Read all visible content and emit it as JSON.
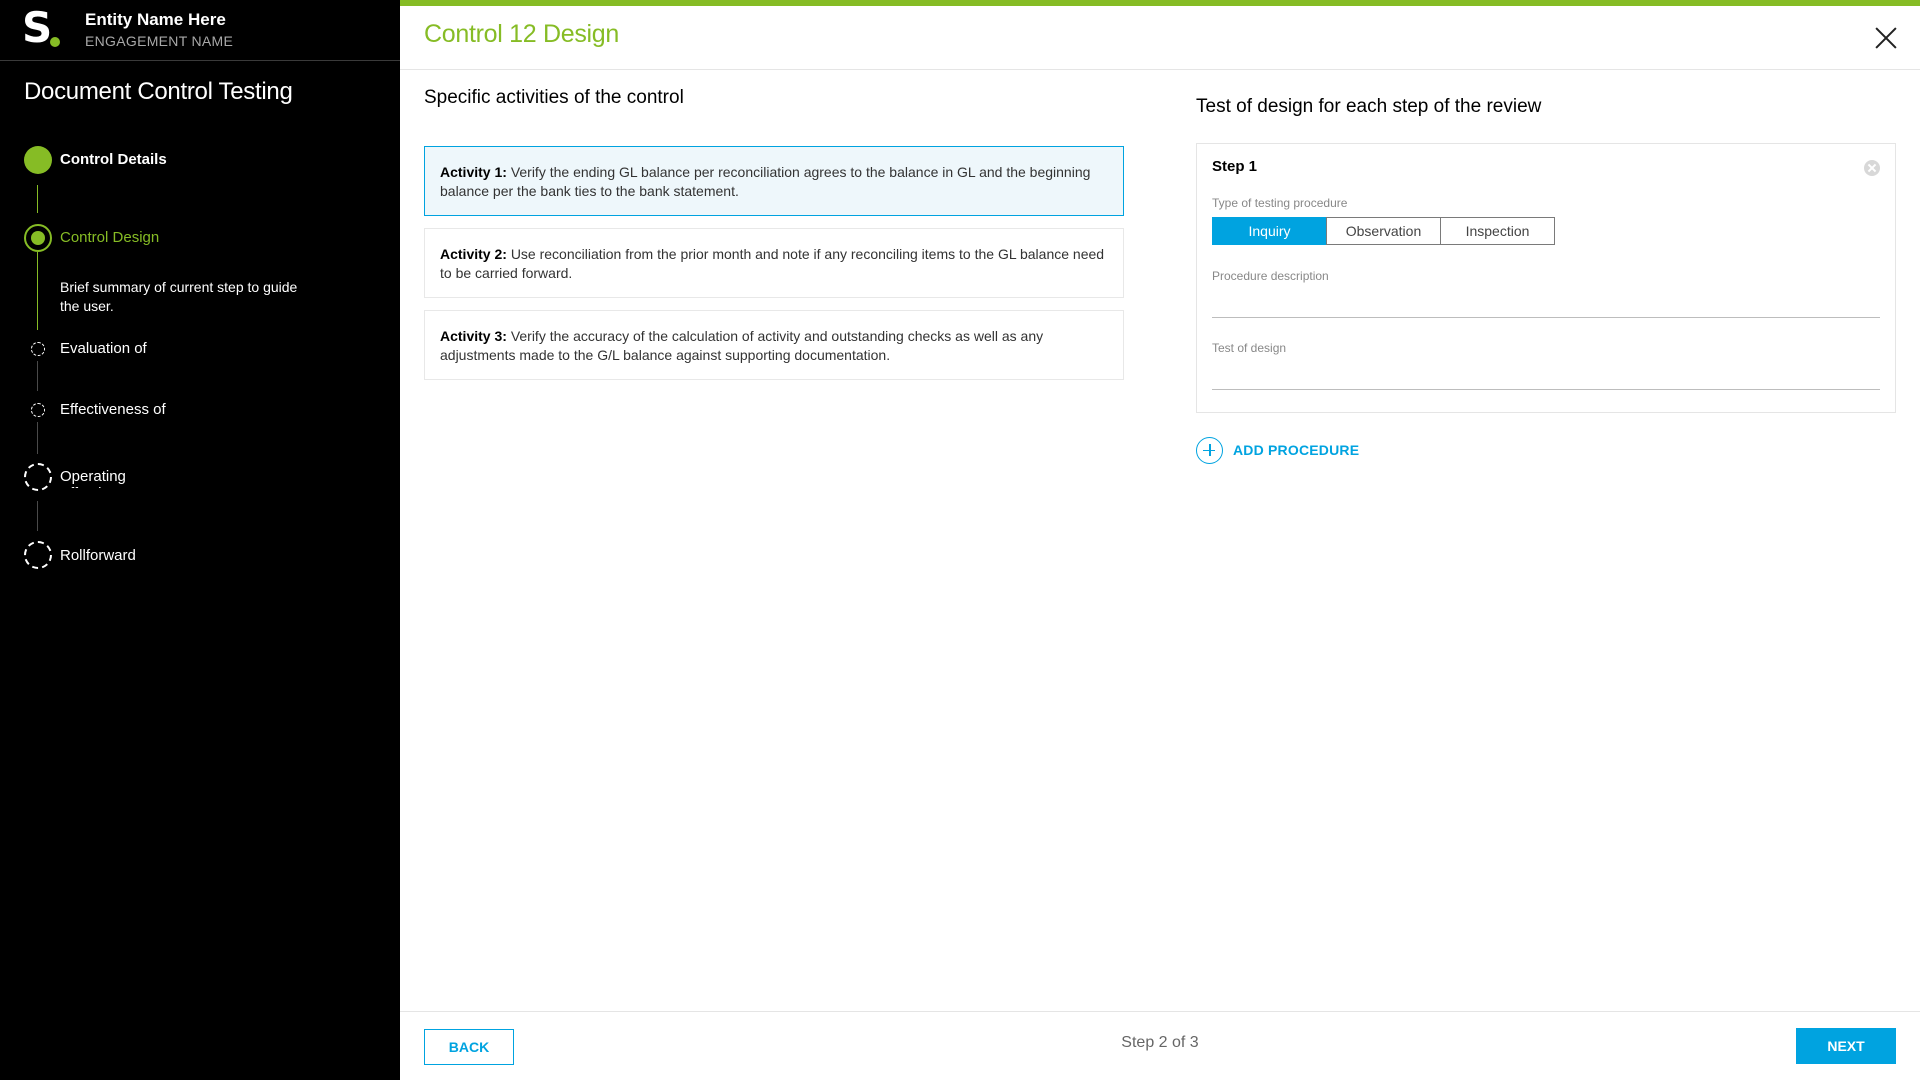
{
  "brand": {
    "logo_letter": "S",
    "entity_name": "Entity Name Here",
    "engagement_name": "ENGAGEMENT NAME"
  },
  "sidebar": {
    "title": "Document Control Testing",
    "steps": [
      {
        "label": "Control Details",
        "status": "complete"
      },
      {
        "label": "Control Design",
        "status": "current",
        "summary": "Brief summary of current step to guide the user."
      },
      {
        "label": "Evaluation of",
        "status": "sub-pending"
      },
      {
        "label": "Effectiveness of",
        "status": "sub-pending"
      },
      {
        "label": "Operating Effectiveness",
        "status": "pending"
      },
      {
        "label": "Rollforward",
        "status": "pending"
      }
    ]
  },
  "header": {
    "title": "Control 12 Design"
  },
  "activities": {
    "title": "Specific activities of the control",
    "items": [
      {
        "label": "Activity 1:",
        "text": "Verify the ending GL balance per reconciliation agrees to the balance in GL and the beginning balance per the bank ties to the bank statement.",
        "selected": true
      },
      {
        "label": "Activity 2:",
        "text": "Use reconciliation from the prior month and note if any reconciling items to the GL balance need to be carried forward.",
        "selected": false
      },
      {
        "label": "Activity 3:",
        "text": "Verify the accuracy of the calculation of activity and outstanding checks as well as any adjustments made to the G/L balance against supporting documentation.",
        "selected": false
      }
    ]
  },
  "test_design": {
    "title": "Test of design for each step of the review",
    "step_title": "Step 1",
    "type_label": "Type of testing procedure",
    "types": [
      "Inquiry",
      "Observation",
      "Inspection"
    ],
    "selected_type": "Inquiry",
    "procedure_label": "Procedure description",
    "procedure_value": "",
    "test_label": "Test of design",
    "test_value": "",
    "add_label": "ADD PROCEDURE"
  },
  "footer": {
    "back_label": "BACK",
    "step_indicator": "Step 2 of 3",
    "next_label": "NEXT"
  },
  "colors": {
    "brand_green": "#86bc25",
    "accent_blue": "#00a3e0",
    "sidebar_bg": "#000000"
  }
}
